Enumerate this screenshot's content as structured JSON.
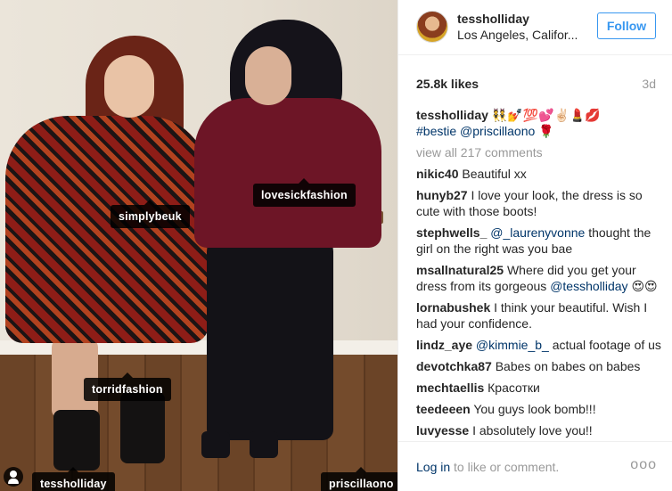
{
  "photo": {
    "tags": {
      "simplybeuk": "simplybeuk",
      "lovesickfashion": "lovesickfashion",
      "torridfashion": "torridfashion",
      "tessholliday": "tessholliday",
      "priscillaono": "priscillaono"
    }
  },
  "header": {
    "username": "tessholliday",
    "location": "Los Angeles, Califor...",
    "follow_label": "Follow"
  },
  "stats": {
    "likes": "25.8k likes",
    "age": "3d"
  },
  "caption": {
    "user": "tessholliday",
    "emoji": "👯💅💯💕✌🏻💄💋",
    "hashtag": "#bestie",
    "mention": "@priscillaono",
    "emoji2": "🌹"
  },
  "view_all": "view all 217 comments",
  "comments": [
    {
      "user": "nikic40",
      "text": "Beautiful xx"
    },
    {
      "user": "hunyb27",
      "text": "I love your look, the dress is so cute with those boots!"
    },
    {
      "user": "stephwells_",
      "mention": "@_laurenyvonne",
      "text": "thought the girl on the right was you bae"
    },
    {
      "user": "msallnatural25",
      "text": "Where did you get your dress from its gorgeous",
      "mention": "@tessholliday",
      "emoji": "😍😍"
    },
    {
      "user": "lornabushek",
      "text": "I think your beautiful. Wish I had your confidence."
    },
    {
      "user": "lindz_aye",
      "mention": "@kimmie_b_",
      "text": "actual footage of us"
    },
    {
      "user": "devotchka87",
      "text": "Babes on babes on babes"
    },
    {
      "user": "mechtaellis",
      "text": "Красотки"
    },
    {
      "user": "teedeeen",
      "text": "You guys look bomb!!!"
    },
    {
      "user": "luvyesse",
      "text": "I absolutely love you!!"
    }
  ],
  "footer": {
    "login_link": "Log in",
    "login_text": "to like or comment.",
    "more": "ooo"
  }
}
